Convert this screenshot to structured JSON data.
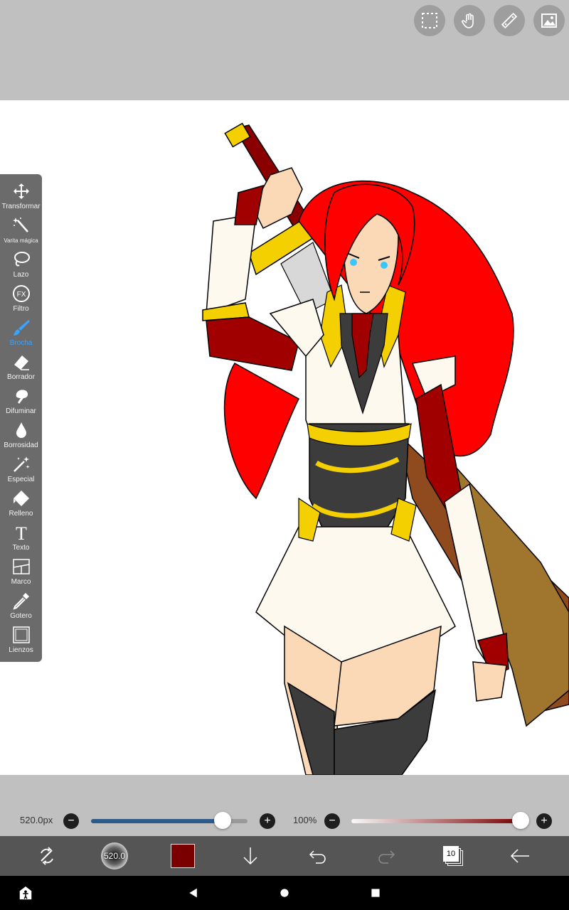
{
  "top_actions": [
    {
      "name": "selection-icon"
    },
    {
      "name": "hand-tool-icon"
    },
    {
      "name": "ruler-icon"
    },
    {
      "name": "image-import-icon"
    }
  ],
  "tools": [
    {
      "label": "Transformar",
      "icon": "move-arrows-icon",
      "active": false
    },
    {
      "label": "Varita mágica",
      "icon": "magic-wand-icon",
      "active": false
    },
    {
      "label": "Lazo",
      "icon": "lasso-icon",
      "active": false
    },
    {
      "label": "Filtro",
      "icon": "fx-icon",
      "active": false
    },
    {
      "label": "Brocha",
      "icon": "brush-icon",
      "active": true
    },
    {
      "label": "Borrador",
      "icon": "eraser-icon",
      "active": false
    },
    {
      "label": "Difuminar",
      "icon": "blur-icon",
      "active": false
    },
    {
      "label": "Borrosidad",
      "icon": "droplet-icon",
      "active": false
    },
    {
      "label": "Especial",
      "icon": "sparkle-wand-icon",
      "active": false
    },
    {
      "label": "Relleno",
      "icon": "fill-bucket-icon",
      "active": false
    },
    {
      "label": "Texto",
      "icon": "text-icon",
      "active": false
    },
    {
      "label": "Marco",
      "icon": "frame-icon",
      "active": false
    },
    {
      "label": "Gotero",
      "icon": "eyedropper-icon",
      "active": false
    },
    {
      "label": "Lienzos",
      "icon": "canvas-icon",
      "active": false
    }
  ],
  "brush": {
    "size_label": "520.0px",
    "size_fraction": 0.84,
    "opacity_label": "100%",
    "opacity_fraction": 1.0,
    "preview_label": "520.0",
    "color": "#7a0000",
    "accent": "#2e5a8a"
  },
  "layers": {
    "count": "10"
  },
  "colors": {
    "hair": "#ff0000",
    "dark_red": "#a00000",
    "gold": "#f5d000",
    "cream": "#fdf9ef",
    "armor": "#3c3c3c",
    "skin": "#fcd9b6",
    "cape": "#8f4a1d"
  }
}
